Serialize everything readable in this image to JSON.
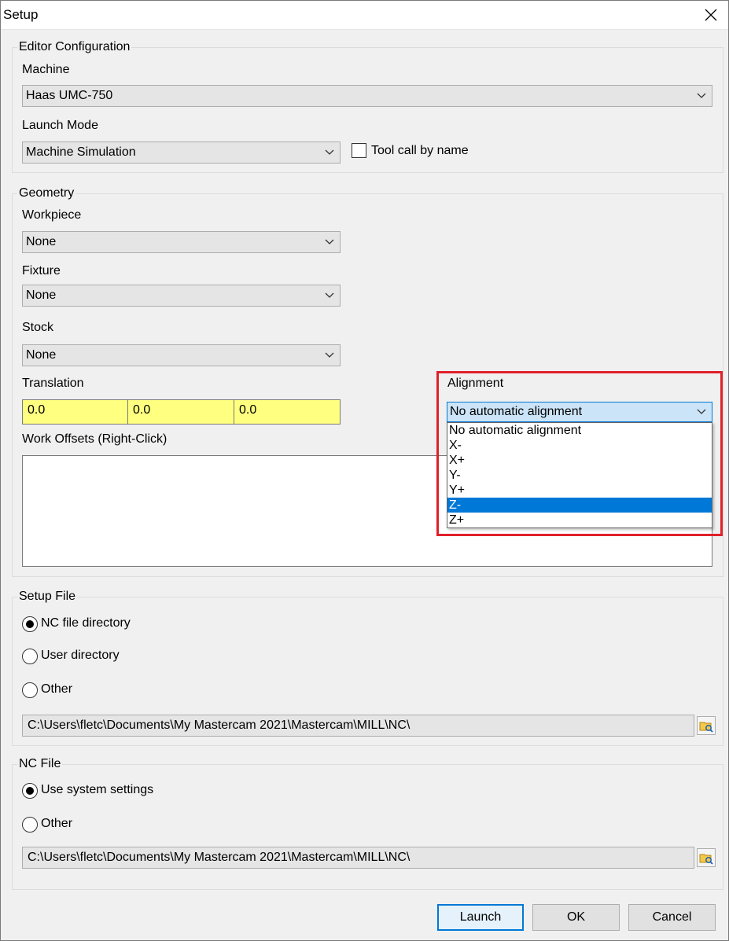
{
  "window": {
    "title": "Setup"
  },
  "editor_config": {
    "title": "Editor Configuration",
    "machine_label": "Machine",
    "machine_value": "Haas UMC-750",
    "launch_mode_label": "Launch Mode",
    "launch_mode_value": "Machine Simulation",
    "tool_call_label": "Tool call by name",
    "tool_call_checked": false
  },
  "geometry": {
    "title": "Geometry",
    "workpiece_label": "Workpiece",
    "workpiece_value": "None",
    "fixture_label": "Fixture",
    "fixture_value": "None",
    "stock_label": "Stock",
    "stock_value": "None",
    "translation_label": "Translation",
    "translation": [
      "0.0",
      "0.0",
      "0.0"
    ],
    "work_offsets_label": "Work Offsets (Right-Click)",
    "alignment_label": "Alignment",
    "alignment_value": "No automatic alignment",
    "alignment_options": [
      "No automatic alignment",
      "X-",
      "X+",
      "Y-",
      "Y+",
      "Z-",
      "Z+"
    ],
    "alignment_hovered": "Z-"
  },
  "setup_file": {
    "title": "Setup File",
    "options": [
      "NC file directory",
      "User directory",
      "Other"
    ],
    "selected": "NC file directory",
    "path": "C:\\Users\\fletc\\Documents\\My Mastercam 2021\\Mastercam\\MILL\\NC\\"
  },
  "nc_file": {
    "title": "NC File",
    "options": [
      "Use system settings",
      "Other"
    ],
    "selected": "Use system settings",
    "path": "C:\\Users\\fletc\\Documents\\My Mastercam 2021\\Mastercam\\MILL\\NC\\"
  },
  "buttons": {
    "launch": "Launch",
    "ok": "OK",
    "cancel": "Cancel"
  },
  "colors": {
    "translation_bg": "#ffff80",
    "selection": "#0078d7",
    "highlight": "#e0202a"
  }
}
